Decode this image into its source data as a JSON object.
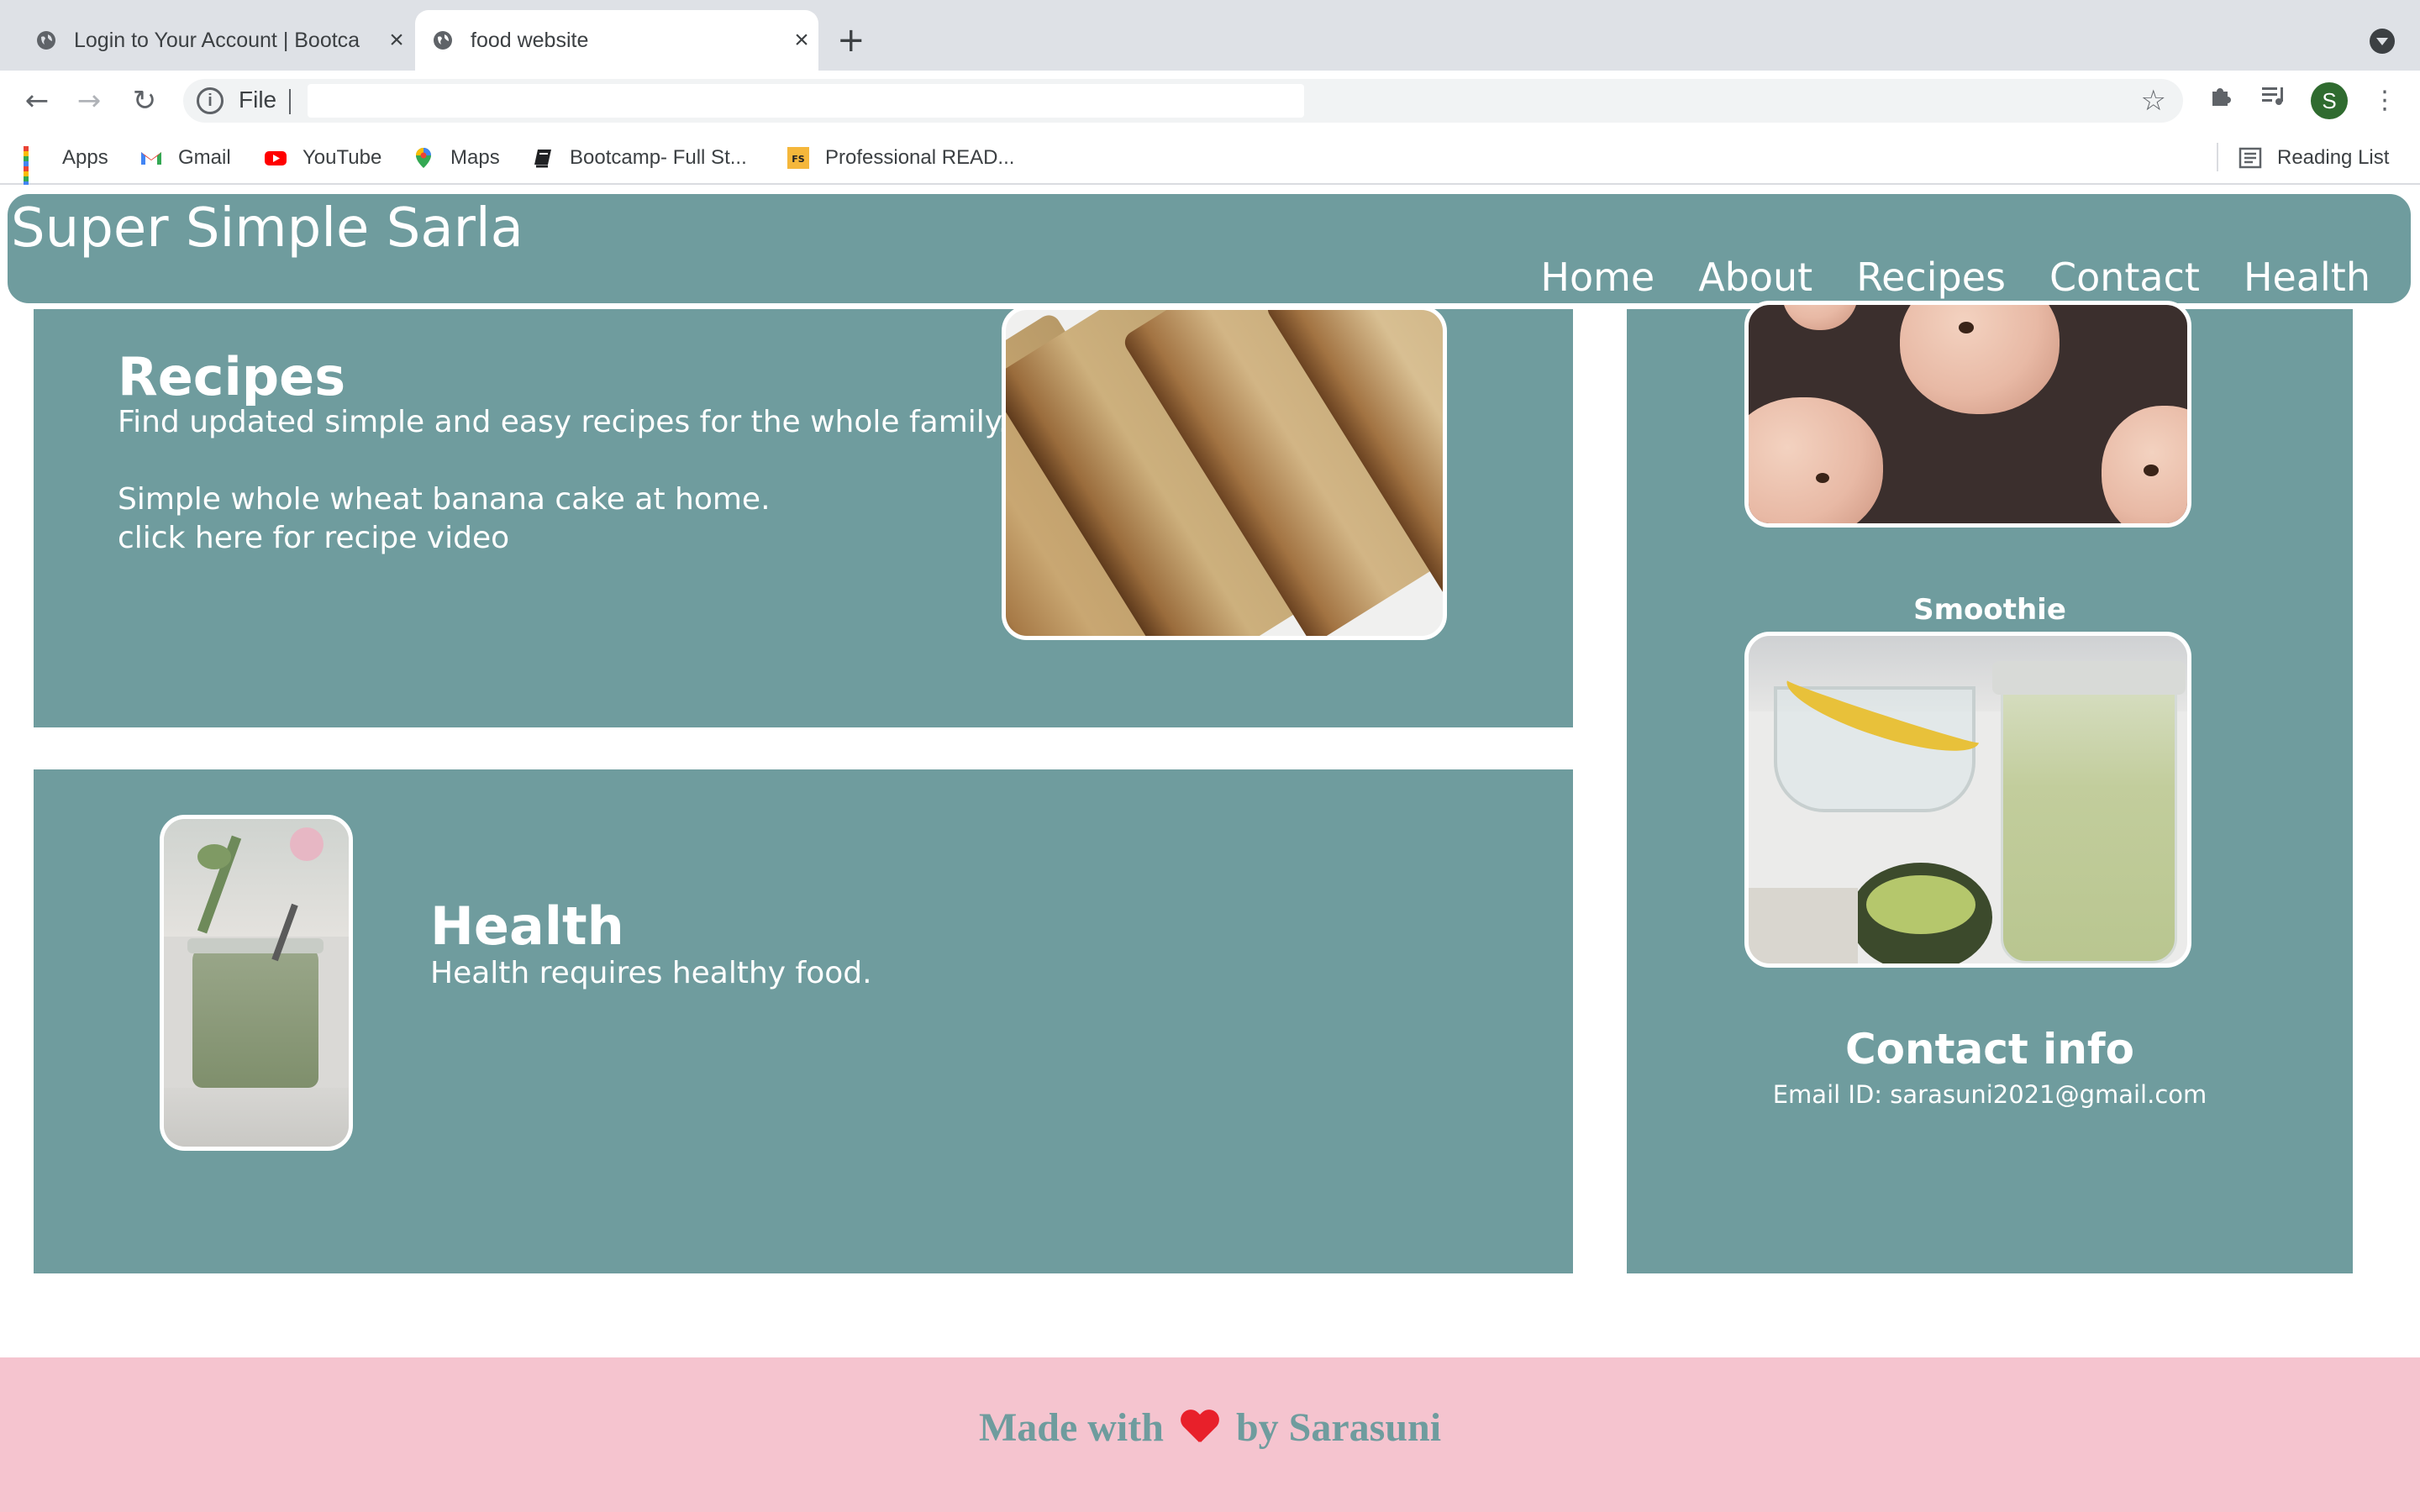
{
  "browser": {
    "tabs": [
      {
        "title": "Login to Your Account | Bootca",
        "active": false
      },
      {
        "title": "food website",
        "active": true
      }
    ],
    "address": {
      "scheme": "File",
      "url": ""
    },
    "bookmarks": [
      {
        "label": "Apps",
        "icon": "apps-grid-icon"
      },
      {
        "label": "Gmail",
        "icon": "gmail-icon"
      },
      {
        "label": "YouTube",
        "icon": "youtube-icon"
      },
      {
        "label": "Maps",
        "icon": "maps-pin-icon"
      },
      {
        "label": "Bootcamp- Full St...",
        "icon": "book-icon"
      },
      {
        "label": "Professional READ...",
        "icon": "fs-icon"
      }
    ],
    "reading_list": "Reading List",
    "profile_initial": "S"
  },
  "site": {
    "title": "Super Simple Sarla",
    "nav": [
      "Home",
      "About",
      "Recipes",
      "Contact",
      "Health"
    ]
  },
  "recipes": {
    "heading": "Recipes",
    "line1": "Find updated simple and easy recipes for the whole family.",
    "line2": "Simple whole wheat banana cake at home.",
    "link": "click here for recipe video"
  },
  "health": {
    "heading": "Health",
    "text": "Health requires healthy food."
  },
  "sidebar": {
    "smoothie_label": "Smoothie",
    "contact_heading": "Contact info",
    "email": "Email ID: sarasuni2021@gmail.com"
  },
  "footer": {
    "before": "Made with",
    "after": "by Sarasuni"
  },
  "colors": {
    "teal": "#6f9c9e",
    "footer_pink": "#f5c4cf",
    "heart": "#e8202a"
  }
}
